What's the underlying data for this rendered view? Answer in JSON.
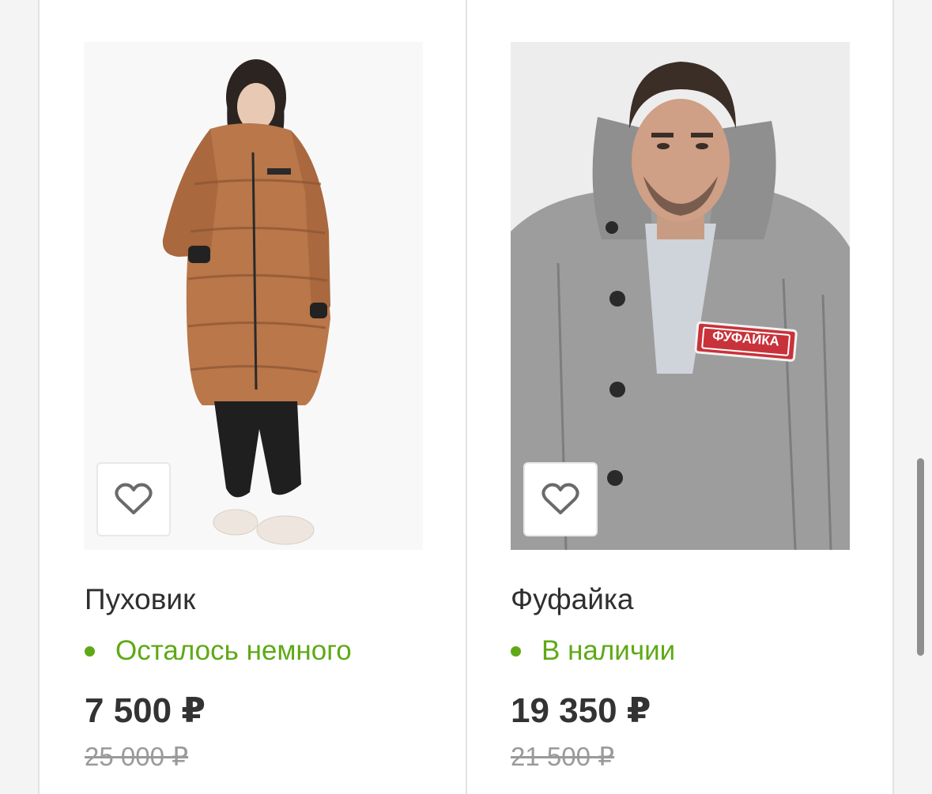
{
  "products": [
    {
      "title": "Пуховик",
      "stock": "Осталось немного",
      "price": "7 500 ₽",
      "old_price": "25 000 ₽",
      "image_icon": "woman-in-long-puffer-coat-photo"
    },
    {
      "title": "Фуфайка",
      "stock": "В наличии",
      "price": "19 350 ₽",
      "old_price": "21 500 ₽",
      "image_icon": "man-in-grey-padded-jacket-photo",
      "patch_text": "ФУФАЙКА"
    }
  ],
  "colors": {
    "in_stock": "#5fa916",
    "price": "#333333",
    "old_price": "#9a9a9a",
    "patch": "#c8323a"
  }
}
